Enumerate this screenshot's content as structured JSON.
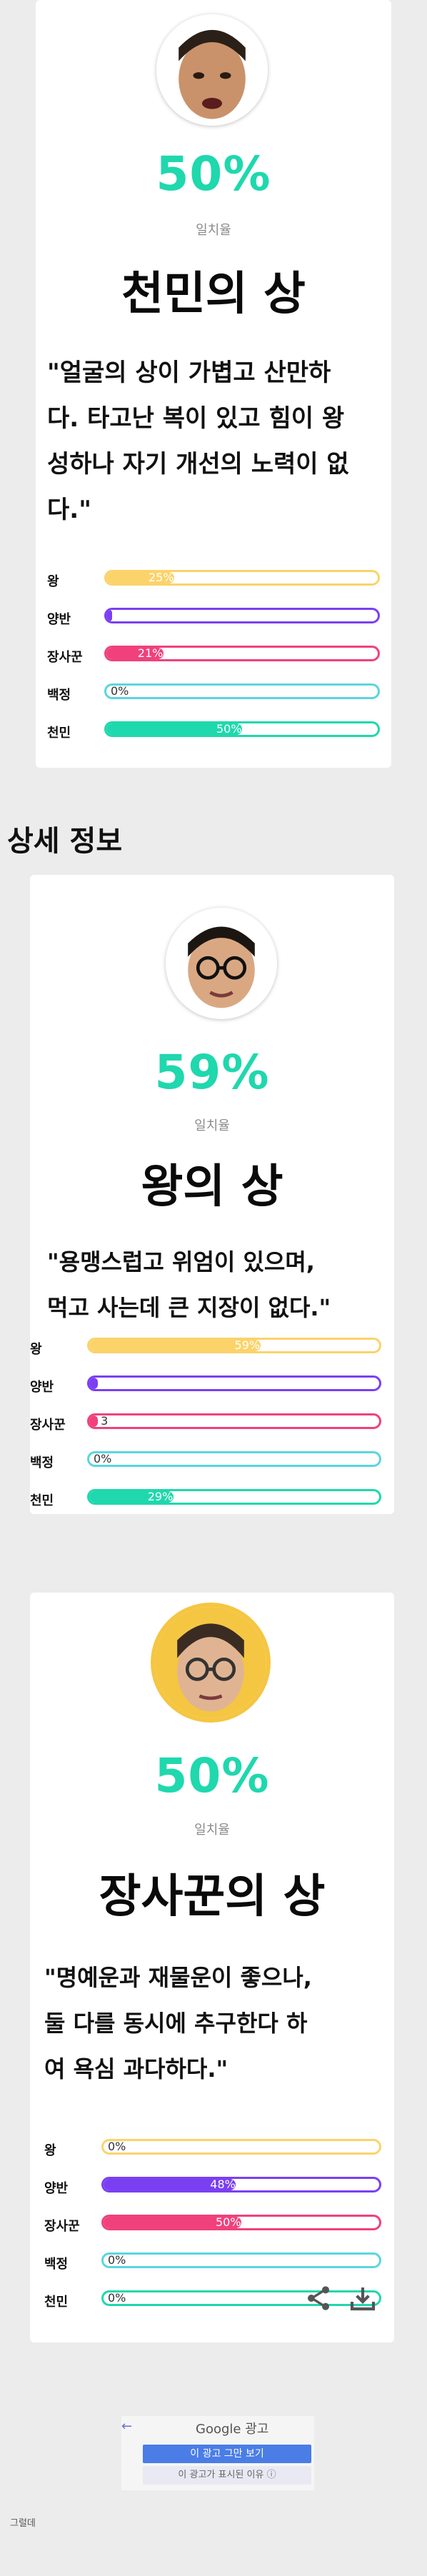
{
  "colors": {
    "accent": "#1fd8ad",
    "king": "#fbd36a",
    "yangban": "#7b3ff2",
    "merchant": "#f0417c",
    "baekjeong": "#5ad6de",
    "cheonmin": "#1fd8ad"
  },
  "section_title": "상세 정보",
  "category_labels": [
    "왕",
    "양반",
    "장사꾼",
    "백정",
    "천민"
  ],
  "results": [
    {
      "percent": "50%",
      "percent_label": "일치율",
      "title": "천민의 상",
      "description": [
        "\"얼굴의 상이 가볍고 산만하",
        "다. 타고난 복이 있고 힘이 왕",
        "성하나 자기 개선의 노력이 없",
        "다.\""
      ],
      "bars": [
        {
          "value": 25,
          "text": "25%"
        },
        {
          "value": 2,
          "text": ""
        },
        {
          "value": 21,
          "text": "21%"
        },
        {
          "value": 0,
          "text": "0%"
        },
        {
          "value": 50,
          "text": "50%"
        }
      ]
    },
    {
      "percent": "59%",
      "percent_label": "일치율",
      "title": "왕의 상",
      "description": [
        "\"용맹스럽고 위엄이 있으며,",
        "먹고 사는데 큰 지장이 없다.\""
      ],
      "bars": [
        {
          "value": 59,
          "text": "59%"
        },
        {
          "value": 3,
          "text": ""
        },
        {
          "value": 3,
          "text": "3"
        },
        {
          "value": 0,
          "text": "0%"
        },
        {
          "value": 29,
          "text": "29%"
        }
      ]
    },
    {
      "percent": "50%",
      "percent_label": "일치율",
      "title": "장사꾼의 상",
      "description": [
        "\"명예운과 재물운이 좋으나,",
        "둘 다를 동시에 추구한다 하",
        "여 욕심 과다하다.\""
      ],
      "bars": [
        {
          "value": 0,
          "text": "0%"
        },
        {
          "value": 48,
          "text": "48%"
        },
        {
          "value": 50,
          "text": "50%"
        },
        {
          "value": 0,
          "text": "0%"
        },
        {
          "value": 0,
          "text": "0%"
        }
      ]
    }
  ],
  "actions": {
    "share_icon": "share-icon",
    "download_icon": "download-icon"
  },
  "ad": {
    "back": "←",
    "brand": "Google 광고",
    "stop_label": "이 광고 그만 보기",
    "why_label": "이 광고가 표시된 이유 ⓘ"
  },
  "footer": "그럴데"
}
